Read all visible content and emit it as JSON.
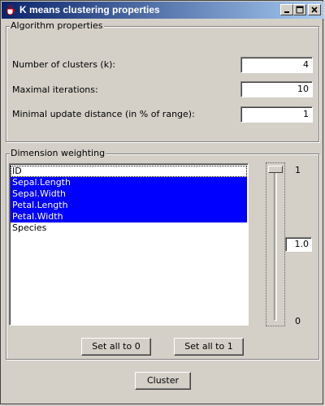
{
  "window": {
    "title": "K means clustering properties"
  },
  "algorithm": {
    "group_label": "Algorithm properties",
    "clusters": {
      "label": "Number of clusters (k):",
      "value": "4"
    },
    "iterations": {
      "label": "Maximal iterations:",
      "value": "10"
    },
    "min_update": {
      "label": "Minimal update distance (in % of range):",
      "value": "1"
    }
  },
  "weighting": {
    "group_label": "Dimension weighting",
    "items": [
      {
        "label": "ID",
        "selected": false
      },
      {
        "label": "Sepal.Length",
        "selected": true
      },
      {
        "label": "Sepal.Width",
        "selected": true
      },
      {
        "label": "Petal.Length",
        "selected": true
      },
      {
        "label": "Petal.Width",
        "selected": true
      },
      {
        "label": "Species",
        "selected": false
      }
    ],
    "slider": {
      "max_label": "1",
      "min_label": "0",
      "value": 1.0,
      "value_text": "1.0"
    },
    "set_all_0_label": "Set all to 0",
    "set_all_1_label": "Set all to 1"
  },
  "cluster_button_label": "Cluster",
  "colors": {
    "title_start": "#0a246a",
    "title_end": "#a6caf0",
    "selection": "#0000ff",
    "face": "#d4d0c8"
  }
}
